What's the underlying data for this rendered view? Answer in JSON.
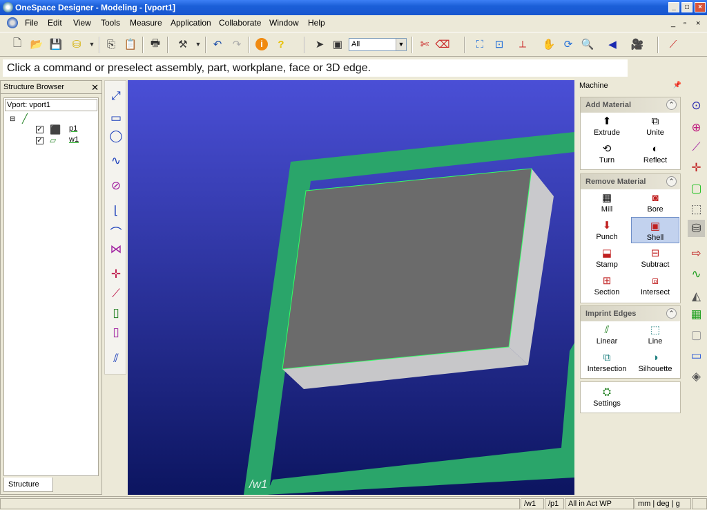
{
  "window": {
    "title": "OneSpace Designer - Modeling - [vport1]"
  },
  "menu": [
    "File",
    "Edit",
    "View",
    "Tools",
    "Measure",
    "Application",
    "Collaborate",
    "Window",
    "Help"
  ],
  "toolbar": {
    "selection_filter": "All"
  },
  "prompt": {
    "text": "Click a command or preselect assembly, part, workplane, face or 3D edge."
  },
  "browser": {
    "title": "Structure Browser",
    "vport": "Vport: vport1",
    "items": [
      {
        "label": "p1"
      },
      {
        "label": "w1"
      }
    ],
    "tab": "Structure"
  },
  "viewport": {
    "workplane_label": "/w1"
  },
  "panel": {
    "title": "Machine",
    "groups": [
      {
        "title": "Add Material",
        "buttons": [
          "Extrude",
          "Unite",
          "Turn",
          "Reflect"
        ]
      },
      {
        "title": "Remove Material",
        "buttons": [
          "Mill",
          "Bore",
          "Punch",
          "Shell",
          "Stamp",
          "Subtract",
          "Section",
          "Intersect"
        ]
      },
      {
        "title": "Imprint Edges",
        "buttons": [
          "Linear",
          "Line",
          "Intersection",
          "Silhouette"
        ]
      },
      {
        "title": "",
        "buttons": [
          "Settings"
        ]
      }
    ],
    "selected_button": "Shell"
  },
  "status": {
    "wp": "/w1",
    "part": "/p1",
    "mode": "All in Act WP",
    "units": "mm | deg | g"
  },
  "colors": {
    "viewport_top": "#4a4fd6",
    "viewport_bottom": "#0c1560",
    "workplane": "#2aa56a",
    "face": "#6b6b6b",
    "side": "#c9c9cc"
  }
}
